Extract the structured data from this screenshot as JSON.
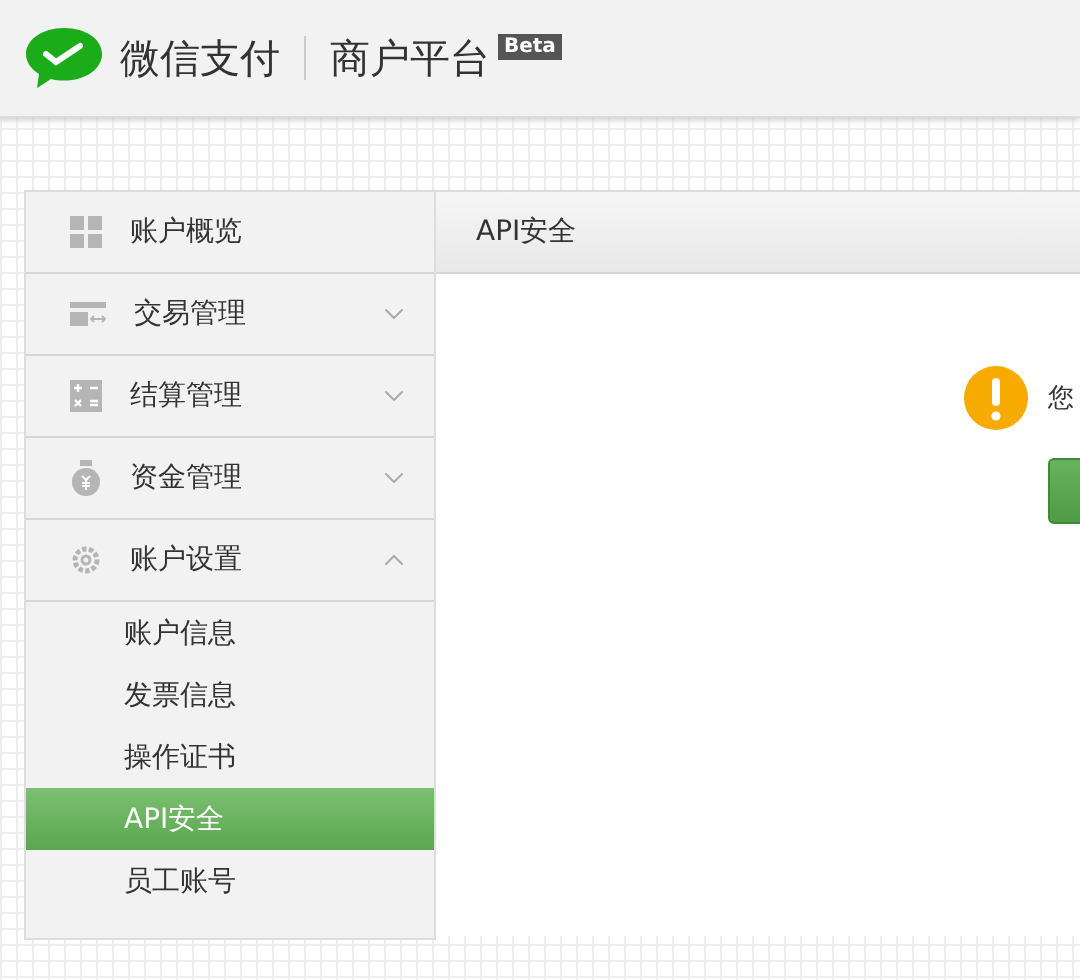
{
  "header": {
    "brand": "微信支付",
    "product": "商户平台",
    "badge": "Beta"
  },
  "sidebar": {
    "items": [
      {
        "label": "账户概览",
        "kind": "grid"
      },
      {
        "label": "交易管理",
        "kind": "card",
        "expanded": false
      },
      {
        "label": "结算管理",
        "kind": "calc",
        "expanded": false
      },
      {
        "label": "资金管理",
        "kind": "bag",
        "expanded": false
      },
      {
        "label": "账户设置",
        "kind": "gear",
        "expanded": true,
        "children": [
          {
            "label": "账户信息",
            "selected": false
          },
          {
            "label": "发票信息",
            "selected": false
          },
          {
            "label": "操作证书",
            "selected": false
          },
          {
            "label": "API安全",
            "selected": true
          },
          {
            "label": "员工账号",
            "selected": false
          }
        ]
      }
    ]
  },
  "main": {
    "title": "API安全",
    "notice": "您"
  }
}
